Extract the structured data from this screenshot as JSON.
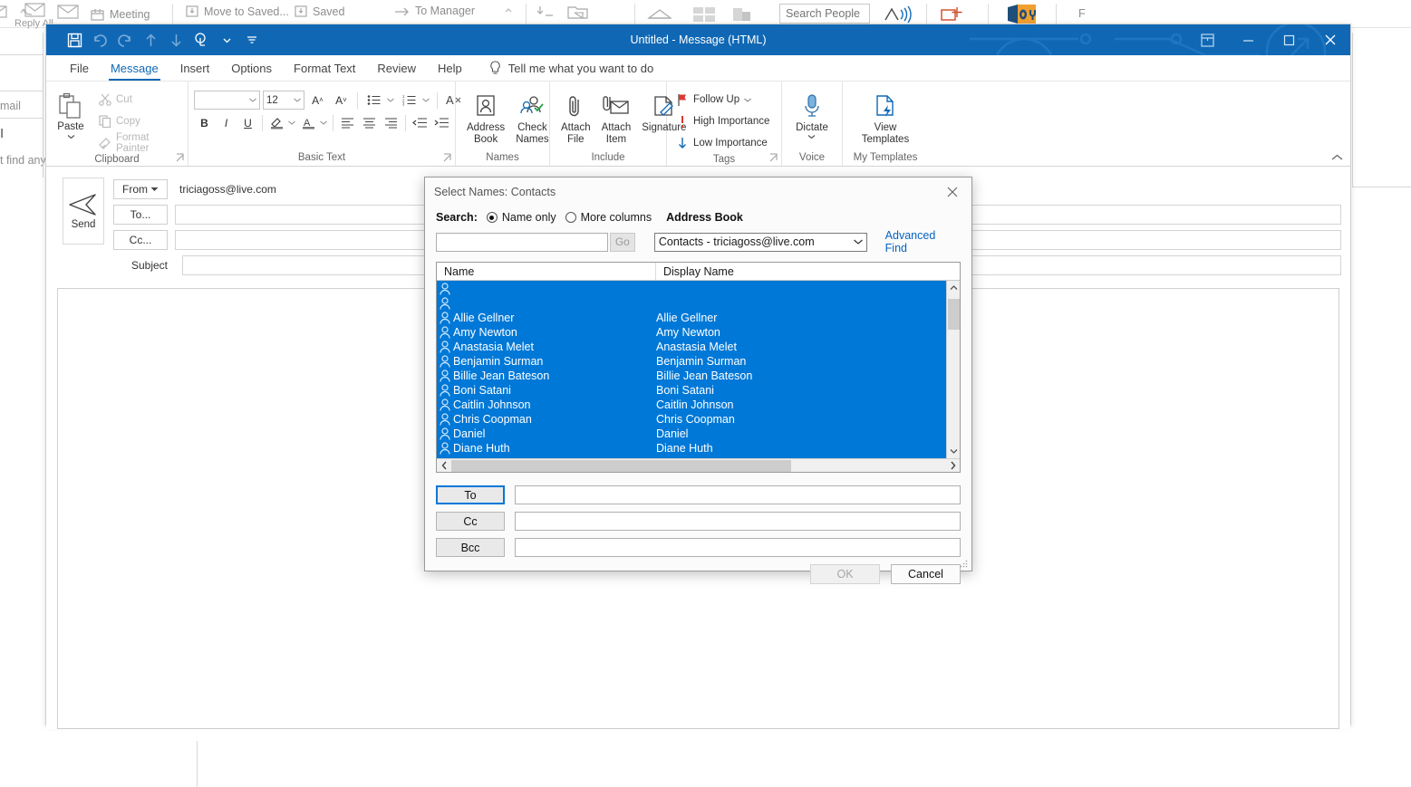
{
  "background": {
    "ribbon_items": [
      {
        "label": "Reply",
        "icon": "reply-icon"
      },
      {
        "label": "Reply All",
        "icon": "reply-all-icon"
      },
      {
        "label": "Meeting",
        "icon": "meeting-icon"
      },
      {
        "label": "Move to Saved...",
        "icon": "move-to-folder-icon"
      },
      {
        "label": "Saved",
        "icon": "move-to-folder-icon"
      },
      {
        "label": "To Manager",
        "icon": "arrow-right-icon"
      }
    ],
    "search_people_placeholder": "Search People",
    "fragment_mail": "mail",
    "fragment_find": "t find anyt"
  },
  "window": {
    "title": "Untitled  -  Message (HTML)",
    "quick_access": [
      {
        "name": "save-icon",
        "glyph": "save"
      },
      {
        "name": "undo-icon",
        "glyph": "undo"
      },
      {
        "name": "redo-icon",
        "glyph": "redo"
      },
      {
        "name": "up-arrow-icon",
        "glyph": "up"
      },
      {
        "name": "down-arrow-icon",
        "glyph": "down"
      },
      {
        "name": "touch-mode-icon",
        "glyph": "touch"
      },
      {
        "name": "customize-qat-icon",
        "glyph": "more"
      }
    ],
    "controls": {
      "ribbon_display": "Ribbon Display Options",
      "minimize": "Minimize",
      "maximize": "Maximize",
      "close": "Close"
    }
  },
  "ribbon": {
    "tabs": [
      {
        "label": "File",
        "active": false
      },
      {
        "label": "Message",
        "active": true
      },
      {
        "label": "Insert",
        "active": false
      },
      {
        "label": "Options",
        "active": false
      },
      {
        "label": "Format Text",
        "active": false
      },
      {
        "label": "Review",
        "active": false
      },
      {
        "label": "Help",
        "active": false
      }
    ],
    "tell_me": "Tell me what you want to do",
    "groups": {
      "clipboard": {
        "label": "Clipboard",
        "paste": "Paste",
        "cut": "Cut",
        "copy": "Copy",
        "format_painter": "Format Painter"
      },
      "basic_text": {
        "label": "Basic Text",
        "font_name": "",
        "font_size": "12",
        "bold": "B",
        "italic": "I",
        "underline": "U"
      },
      "names": {
        "label": "Names",
        "address_book": "Address Book",
        "check_names": "Check Names"
      },
      "include": {
        "label": "Include",
        "attach_file": "Attach File",
        "attach_item": "Attach Item",
        "signature": "Signature"
      },
      "tags": {
        "label": "Tags",
        "follow_up": "Follow Up",
        "high_importance": "High Importance",
        "low_importance": "Low Importance"
      },
      "voice": {
        "label": "Voice",
        "dictate": "Dictate"
      },
      "my_templates": {
        "label": "My Templates",
        "view_templates": "View Templates"
      }
    }
  },
  "compose": {
    "send": "Send",
    "from_label": "From",
    "from_value": "triciagoss@live.com",
    "to_label": "To...",
    "to_value": "",
    "cc_label": "Cc...",
    "cc_value": "",
    "subject_label": "Subject",
    "subject_value": "",
    "body": ""
  },
  "dialog": {
    "title": "Select Names: Contacts",
    "search_label": "Search:",
    "radio_name_only": "Name only",
    "radio_more_columns": "More columns",
    "radio_selected": "Name only",
    "address_book_label": "Address Book",
    "search_value": "",
    "search_placeholder": "",
    "go_button": "Go",
    "address_book_value": "Contacts - triciagoss@live.com",
    "advanced_find": "Advanced Find",
    "columns": [
      "Name",
      "Display Name"
    ],
    "contacts": [
      {
        "name": "",
        "display_name": "",
        "selected": true
      },
      {
        "name": "",
        "display_name": "",
        "selected": true
      },
      {
        "name": "Allie Gellner",
        "display_name": "Allie Gellner",
        "selected": true
      },
      {
        "name": "Amy Newton",
        "display_name": "Amy Newton",
        "selected": true
      },
      {
        "name": "Anastasia Melet",
        "display_name": "Anastasia Melet",
        "selected": true
      },
      {
        "name": "Benjamin Surman",
        "display_name": "Benjamin Surman",
        "selected": true
      },
      {
        "name": "Billie Jean Bateson",
        "display_name": "Billie Jean Bateson",
        "selected": true
      },
      {
        "name": "Boni Satani",
        "display_name": "Boni Satani",
        "selected": true
      },
      {
        "name": "Caitlin Johnson",
        "display_name": "Caitlin Johnson",
        "selected": true
      },
      {
        "name": "Chris Coopman",
        "display_name": "Chris Coopman",
        "selected": true
      },
      {
        "name": "Daniel",
        "display_name": "Daniel",
        "selected": true
      },
      {
        "name": "Diane Huth",
        "display_name": "Diane Huth",
        "selected": true
      }
    ],
    "recipients": {
      "to_label": "To",
      "to_value": "",
      "cc_label": "Cc",
      "cc_value": "",
      "bcc_label": "Bcc",
      "bcc_value": ""
    },
    "ok_button": "OK",
    "cancel_button": "Cancel",
    "ok_enabled": false
  },
  "colors": {
    "accent": "#1068b5",
    "selection": "#0078d7",
    "link": "#0563c1",
    "title_bar": "#1068b5"
  }
}
